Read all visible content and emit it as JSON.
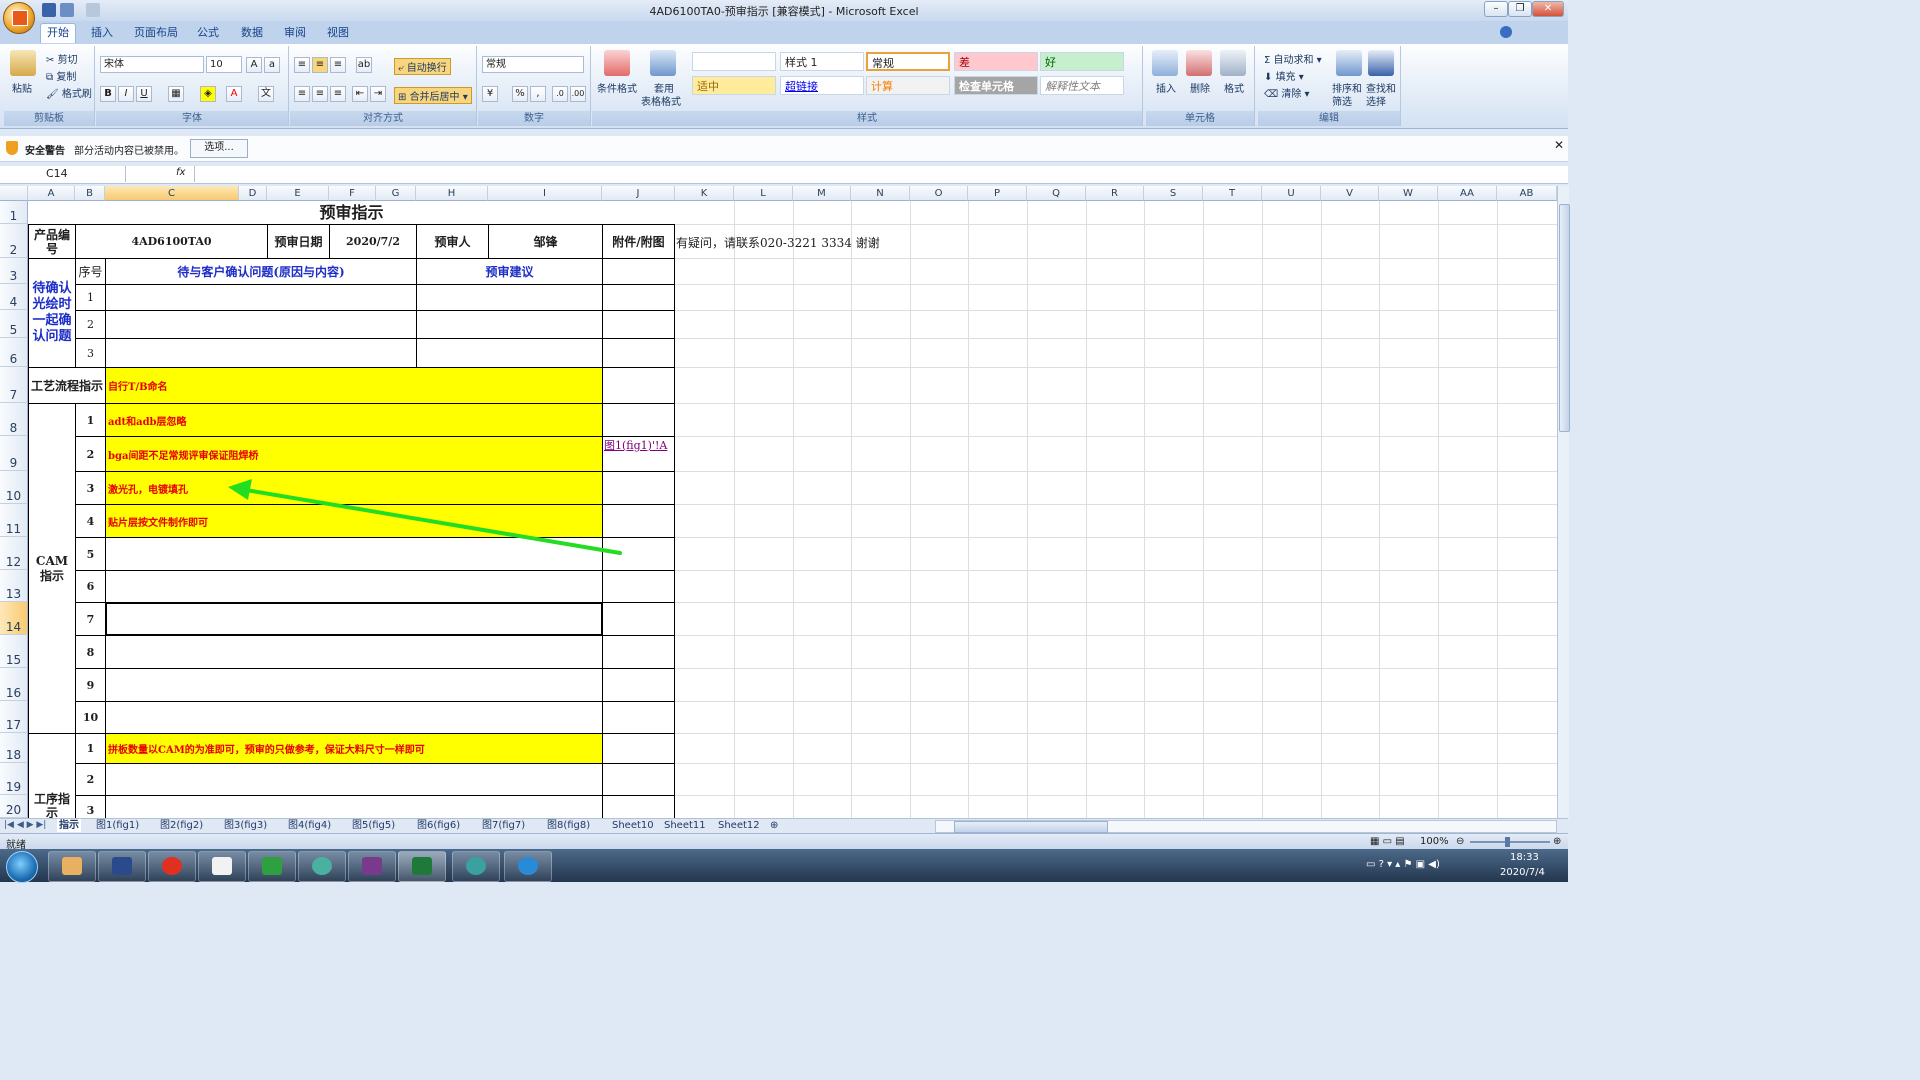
{
  "window": {
    "title": "4AD6100TA0-预审指示  [兼容模式] - Microsoft Excel"
  },
  "tabs": [
    "开始",
    "插入",
    "页面布局",
    "公式",
    "数据",
    "审阅",
    "视图"
  ],
  "ribbon": {
    "clipboard": {
      "paste": "粘贴",
      "cut": "剪切",
      "copy": "复制",
      "format_painter": "格式刷",
      "label": "剪贴板"
    },
    "font": {
      "name": "宋体",
      "size": "10",
      "label": "字体"
    },
    "alignment": {
      "wrap": "自动换行",
      "merge": "合并后居中",
      "label": "对齐方式"
    },
    "number": {
      "format": "常规",
      "label": "数字"
    },
    "styles": {
      "conditional": "条件格式",
      "table": "套用",
      "table2": "表格格式",
      "cells": [
        "样式 1",
        "常规",
        "差",
        "好",
        "适中",
        "超链接",
        "计算",
        "检查单元格",
        "解释性文本"
      ],
      "label": "样式"
    },
    "cells": {
      "insert": "插入",
      "delete": "删除",
      "format": "格式",
      "label": "单元格"
    },
    "editing": {
      "autosum": "自动求和",
      "fill": "填充",
      "clear": "清除",
      "sort": "排序和",
      "sort2": "筛选",
      "find": "查找和",
      "find2": "选择",
      "label": "编辑"
    }
  },
  "security": {
    "label": "安全警告",
    "message": "部分活动内容已被禁用。",
    "button": "选项..."
  },
  "formula_bar": {
    "cell_ref": "C14",
    "fx": "fx",
    "value": ""
  },
  "columns": [
    "A",
    "B",
    "C",
    "D",
    "E",
    "F",
    "G",
    "H",
    "I",
    "J",
    "K",
    "L",
    "M",
    "N",
    "O",
    "P",
    "Q",
    "R",
    "S",
    "T",
    "U",
    "V",
    "W",
    "AA",
    "AB"
  ],
  "rows": [
    "1",
    "2",
    "3",
    "4",
    "5",
    "6",
    "7",
    "8",
    "9",
    "10",
    "11",
    "12",
    "13",
    "14",
    "15",
    "16",
    "17",
    "18",
    "19",
    "20"
  ],
  "sheet": {
    "title": "预审指示",
    "product_label": "产品编号",
    "product_no": "4AD6100TA0",
    "review_date_label": "预审日期",
    "review_date": "2020/7/2",
    "reviewer_label": "预审人",
    "reviewer": "邹锋",
    "attachment_label": "附件/附图",
    "contact_note": "有疑问，请联系020-3221 3334 谢谢",
    "seq_label": "序号",
    "issue_header": "待与客户确认问题(原因与内容)",
    "suggest_header": "预审建议",
    "pending_label": "待确认光绘时一起确认问题",
    "pending_seq": [
      "1",
      "2",
      "3"
    ],
    "process_label": "工艺流程指示",
    "process_text": "自行T/B命名",
    "cam_label": "CAM指示",
    "cam_items": [
      {
        "seq": "1",
        "text": "adt和adb层忽略",
        "link": ""
      },
      {
        "seq": "2",
        "text": "bga间距不足常规评审保证阻焊桥",
        "link": "图1(fig1)'!A"
      },
      {
        "seq": "3",
        "text": "激光孔，电镀填孔",
        "link": ""
      },
      {
        "seq": "4",
        "text": "贴片层按文件制作即可",
        "link": ""
      },
      {
        "seq": "5",
        "text": "",
        "link": ""
      },
      {
        "seq": "6",
        "text": "",
        "link": ""
      },
      {
        "seq": "7",
        "text": "",
        "link": ""
      },
      {
        "seq": "8",
        "text": "",
        "link": ""
      },
      {
        "seq": "9",
        "text": "",
        "link": ""
      },
      {
        "seq": "10",
        "text": "",
        "link": ""
      }
    ],
    "procedure_label": "工序指示",
    "procedure_items": [
      {
        "seq": "1",
        "text": "拼板数量以CAM的为准即可，预审的只做参考，保证大料尺寸一样即可"
      },
      {
        "seq": "2",
        "text": ""
      },
      {
        "seq": "3",
        "text": ""
      }
    ]
  },
  "sheet_tabs": [
    "指示",
    "图1(fig1)",
    "图2(fig2)",
    "图3(fig3)",
    "图4(fig4)",
    "图5(fig5)",
    "图6(fig6)",
    "图7(fig7)",
    "图8(fig8)",
    "Sheet10",
    "Sheet11",
    "Sheet12"
  ],
  "status": {
    "ready": "就绪",
    "zoom": "100%"
  },
  "taskbar": {
    "time": "18:33",
    "date": "2020/7/4"
  },
  "colors": {
    "highlight": "#ffff00",
    "red_text": "#e80000",
    "blue_text": "#1c2ec8",
    "arrow": "#22dd22"
  }
}
